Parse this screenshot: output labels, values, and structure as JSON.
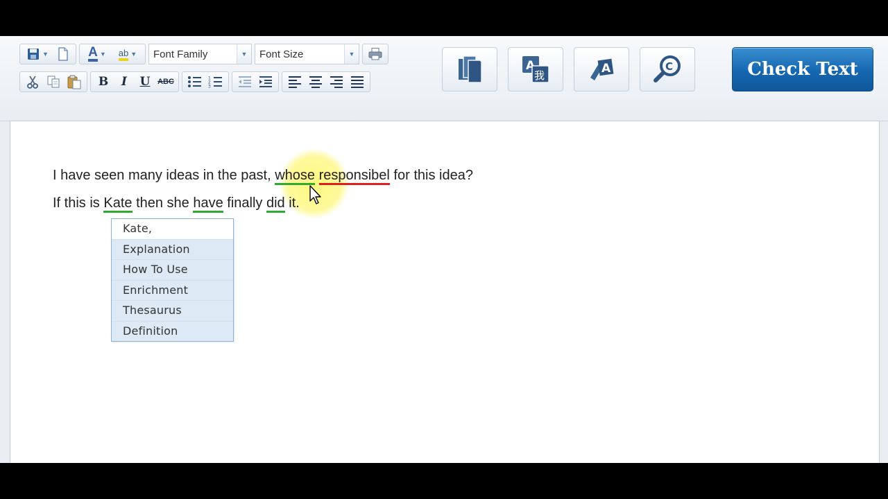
{
  "toolbar": {
    "font_family": {
      "label": "Font Family"
    },
    "font_size": {
      "label": "Font Size"
    },
    "bold_label": "B",
    "italic_label": "I",
    "underline_label": "U",
    "strike_label": "ABC",
    "font_color_label": "A",
    "highlight_label": "ab"
  },
  "check_button": {
    "label": "Check Text"
  },
  "editor": {
    "line1": {
      "before": "I have seen many ideas in the past, ",
      "w1": "whose",
      "sp1": " ",
      "w2": "responsibel",
      "after": " for this idea?"
    },
    "line2": {
      "before": "If this is ",
      "w1": "Kate",
      "mid1": " then she ",
      "w2": "have",
      "mid2": " finally ",
      "w3": "did",
      "after": " it."
    }
  },
  "suggestion_menu": {
    "items": [
      {
        "label": "Kate,"
      },
      {
        "label": "Explanation"
      },
      {
        "label": "How To Use"
      },
      {
        "label": "Enrichment"
      },
      {
        "label": "Thesaurus"
      },
      {
        "label": "Definition"
      }
    ]
  },
  "colors": {
    "accent": "#1567b0",
    "grammar_underline": "#2faa2f",
    "spelling_underline": "#e01e1e",
    "highlight": "#fff878"
  }
}
